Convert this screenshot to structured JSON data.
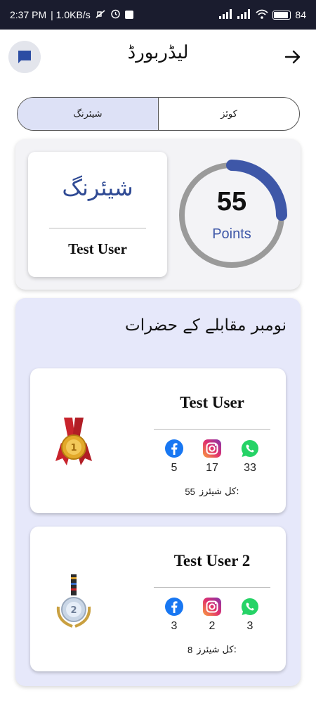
{
  "status_bar": {
    "time": "2:37 PM",
    "net_speed": "| 1.0KB/s",
    "battery": "84"
  },
  "header": {
    "title": "لیڈربورڈ"
  },
  "tabs": [
    {
      "label": "شیئرنگ",
      "selected": true
    },
    {
      "label": "کوئز",
      "selected": false
    }
  ],
  "summary": {
    "category": "شیئرنگ",
    "user": "Test User",
    "points_value": "55",
    "points_label": "Points",
    "progress_fraction": 0.25
  },
  "leaderboard": {
    "title": "نومبر مقابلے کے حضرات",
    "total_label": "کل شیئرز:",
    "entries": [
      {
        "rank": "1",
        "name": "Test User",
        "facebook": "5",
        "instagram": "17",
        "whatsapp": "33",
        "total": "55"
      },
      {
        "rank": "2",
        "name": "Test User 2",
        "facebook": "3",
        "instagram": "2",
        "whatsapp": "3",
        "total": "8"
      }
    ]
  },
  "colors": {
    "accent": "#3e57a8",
    "tab_selected": "#dde1f6",
    "panel_bg": "#e6e8fa",
    "facebook": "#1877f2",
    "whatsapp": "#25d366"
  },
  "icons": [
    "chat-icon",
    "arrow-right-icon",
    "gold-medal-icon",
    "silver-medal-icon",
    "facebook-icon",
    "instagram-icon",
    "whatsapp-icon"
  ]
}
